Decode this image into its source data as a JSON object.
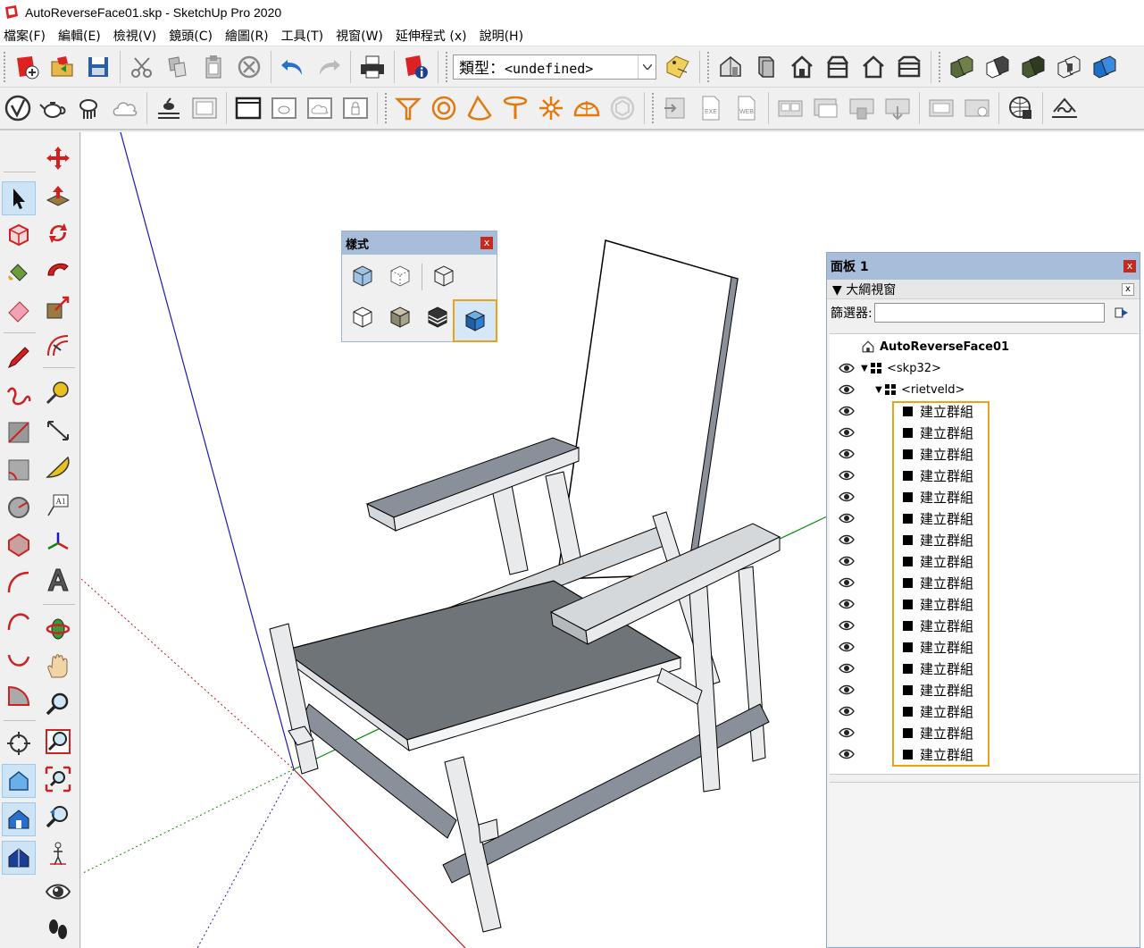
{
  "window": {
    "title": "AutoReverseFace01.skp - SketchUp Pro 2020"
  },
  "menu": [
    "檔案(F)",
    "編輯(E)",
    "檢視(V)",
    "鏡頭(C)",
    "繪圖(R)",
    "工具(T)",
    "視窗(W)",
    "延伸程式 (x)",
    "說明(H)"
  ],
  "toolbar": {
    "type_label": "類型：",
    "type_value": "<undefined>"
  },
  "styles_panel": {
    "title": "樣式",
    "close": "x",
    "buttons": [
      "x-ray-style",
      "back-edges-style",
      "wireframe-style",
      "hidden-line-style",
      "shaded-style",
      "shaded-with-textures-style",
      "monochrome-style"
    ]
  },
  "tray": {
    "title": "面板 1",
    "close": "x",
    "outliner": {
      "title": "大綱視窗",
      "close": "x",
      "filter_label": "篩選器:",
      "filter_value": "",
      "root": "AutoReverseFace01",
      "comp1": "<skp32>",
      "comp2": "<rietveld>",
      "groups": [
        "建立群組",
        "建立群組",
        "建立群組",
        "建立群組",
        "建立群組",
        "建立群組",
        "建立群組",
        "建立群組",
        "建立群組",
        "建立群組",
        "建立群組",
        "建立群組",
        "建立群組",
        "建立群組",
        "建立群組",
        "建立群組",
        "建立群組"
      ]
    }
  },
  "colors": {
    "panel_header": "#a8bdd9",
    "highlight": "#e8a21b",
    "seat_fill": "#6f7479",
    "axis_blue": "#1a1ab4",
    "axis_red": "#c01010",
    "axis_green": "#0a8a0a"
  }
}
